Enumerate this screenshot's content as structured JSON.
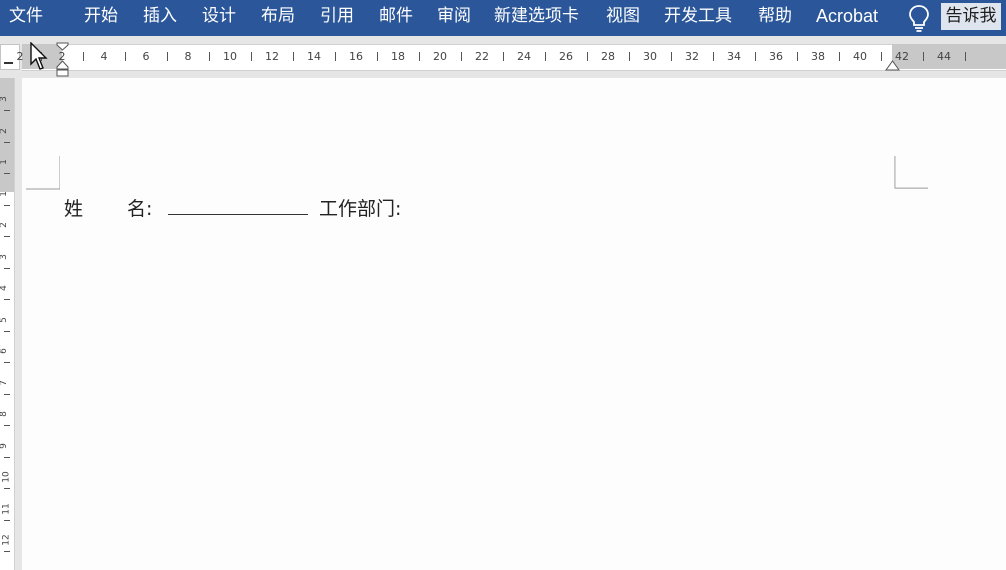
{
  "ribbon": {
    "tabs": [
      {
        "key": "file",
        "label": "文件"
      },
      {
        "key": "home",
        "label": "开始"
      },
      {
        "key": "insert",
        "label": "插入"
      },
      {
        "key": "design",
        "label": "设计"
      },
      {
        "key": "layout",
        "label": "布局"
      },
      {
        "key": "references",
        "label": "引用"
      },
      {
        "key": "mailings",
        "label": "邮件"
      },
      {
        "key": "review",
        "label": "审阅"
      },
      {
        "key": "new_tab",
        "label": "新建选项卡"
      },
      {
        "key": "view",
        "label": "视图"
      },
      {
        "key": "developer",
        "label": "开发工具"
      },
      {
        "key": "help",
        "label": "帮助"
      },
      {
        "key": "acrobat",
        "label": "Acrobat"
      }
    ],
    "tell_me": "告诉我",
    "bulb_icon": "lightbulb-icon"
  },
  "ruler": {
    "labels": [
      "2",
      "2",
      "4",
      "6",
      "8",
      "10",
      "12",
      "14",
      "16",
      "18",
      "20",
      "22",
      "24",
      "26",
      "28",
      "30",
      "32",
      "34",
      "36",
      "38",
      "40",
      "42",
      "44"
    ],
    "vertical_labels": [
      "3",
      "2",
      "1",
      "1",
      "2",
      "3",
      "4",
      "5",
      "6",
      "7",
      "8",
      "9",
      "10",
      "11",
      "12"
    ]
  },
  "document": {
    "name_label": "姓",
    "name_label2": "名:",
    "dept_label": "工作部门:"
  },
  "colors": {
    "ribbon": "#2b579a",
    "ruler_margin": "#c8c8c8",
    "page": "#fdfdfd"
  }
}
